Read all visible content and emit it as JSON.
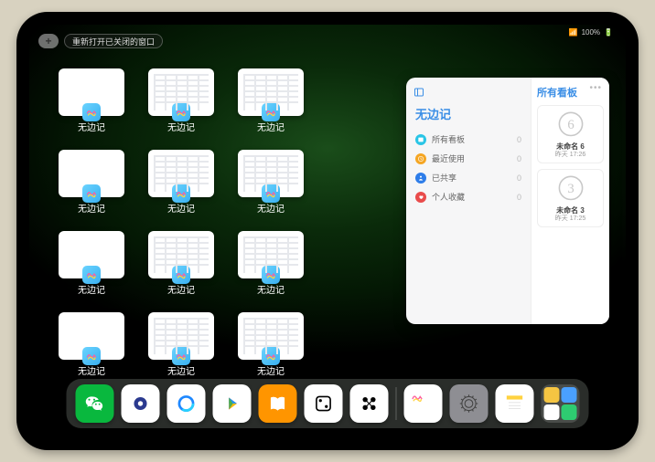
{
  "status": {
    "battery": "100%",
    "signal": "••••"
  },
  "top": {
    "plus": "+",
    "reopen_label": "重新打开已关闭的窗口"
  },
  "app_label": "无边记",
  "grid": {
    "cells": [
      {
        "variant": "blank"
      },
      {
        "variant": "cal"
      },
      {
        "variant": "cal"
      },
      {
        "variant": "blank"
      },
      {
        "variant": "cal"
      },
      {
        "variant": "cal"
      },
      {
        "variant": "blank"
      },
      {
        "variant": "cal"
      },
      {
        "variant": "cal"
      },
      {
        "variant": "blank"
      },
      {
        "variant": "cal"
      },
      {
        "variant": "cal"
      }
    ]
  },
  "panel": {
    "title": "无边记",
    "right_title": "所有看板",
    "ellipsis": "•••",
    "menu": [
      {
        "label": "所有看板",
        "count": 0,
        "color": "#29c5e6"
      },
      {
        "label": "最近使用",
        "count": 0,
        "color": "#f5a623"
      },
      {
        "label": "已共享",
        "count": 0,
        "color": "#2e7de9"
      },
      {
        "label": "个人收藏",
        "count": 0,
        "color": "#e94b4b"
      }
    ],
    "cards": [
      {
        "title": "未命名 6",
        "sub": "昨天 17:26",
        "digit": "6"
      },
      {
        "title": "未命名 3",
        "sub": "昨天 17:25",
        "digit": "3"
      }
    ]
  },
  "dock": {
    "apps": [
      {
        "name": "wechat",
        "bg": "#09b83e"
      },
      {
        "name": "quark",
        "bg": "#ffffff"
      },
      {
        "name": "qq-browser",
        "bg": "#ffffff"
      },
      {
        "name": "media-player",
        "bg": "#ffffff"
      },
      {
        "name": "books",
        "bg": "#ff9500"
      },
      {
        "name": "dice",
        "bg": "#ffffff"
      },
      {
        "name": "connect",
        "bg": "#ffffff"
      }
    ],
    "recent": [
      {
        "name": "freeform",
        "bg": "#ffffff"
      },
      {
        "name": "settings",
        "bg": "#8e8e93"
      },
      {
        "name": "notes",
        "bg": "#ffffff"
      }
    ],
    "recent_group": [
      "#f5c542",
      "#4aa0ff",
      "#ffffff",
      "#2ecc71"
    ]
  }
}
